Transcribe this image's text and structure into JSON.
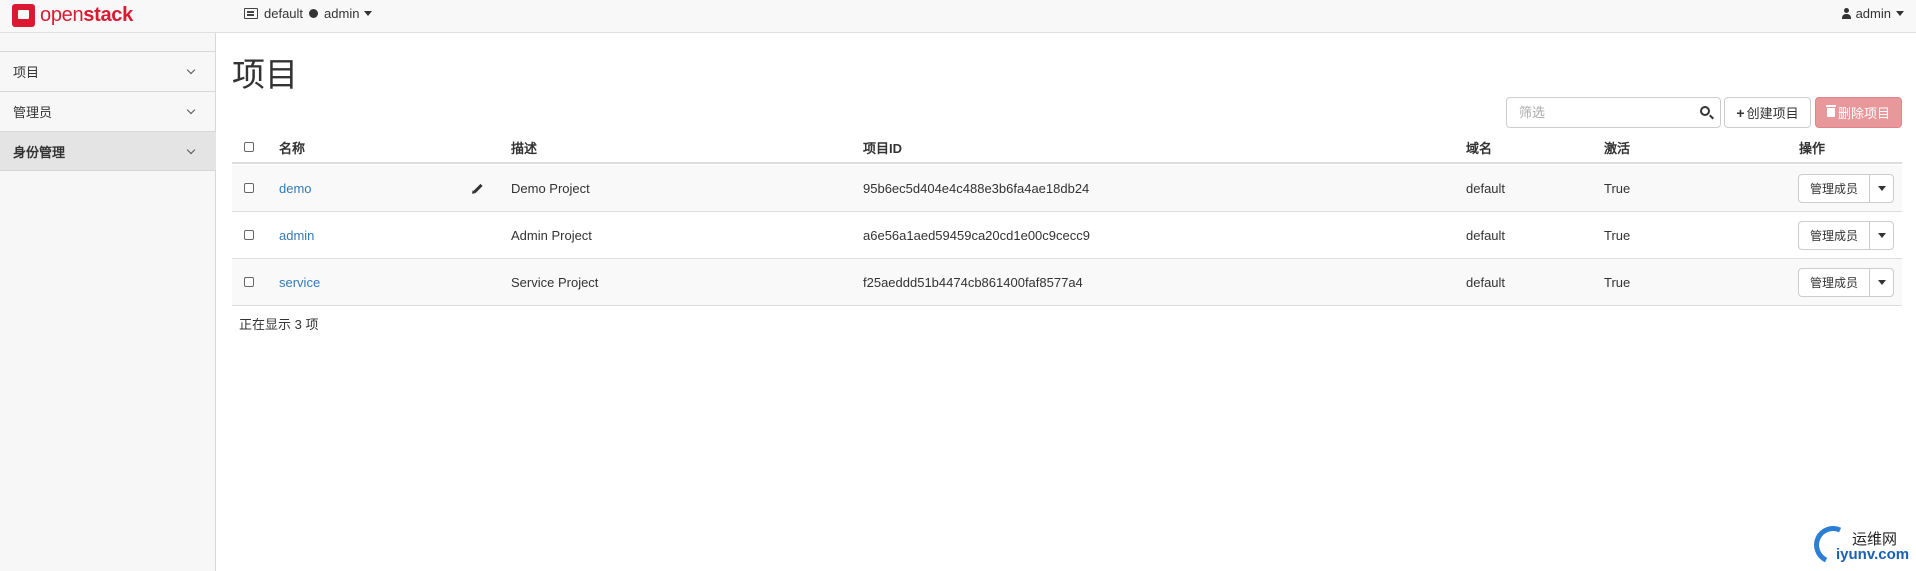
{
  "navbar": {
    "brand_open": "open",
    "brand_stack": "stack",
    "domain": "default",
    "project": "admin",
    "user": "admin"
  },
  "sidebar": {
    "items": [
      {
        "label": "项目",
        "active": false
      },
      {
        "label": "管理员",
        "active": false
      },
      {
        "label": "身份管理",
        "active": true
      }
    ]
  },
  "main": {
    "title": "项目",
    "filter_placeholder": "筛选",
    "create_label": "创建项目",
    "delete_label": "删除项目",
    "columns": [
      "名称",
      "描述",
      "项目ID",
      "域名",
      "激活",
      "操作"
    ],
    "rows": [
      {
        "name": "demo",
        "description": "Demo Project",
        "id": "95b6ec5d404e4c488e3b6fa4ae18db24",
        "domain": "default",
        "enabled": "True",
        "action": "管理成员"
      },
      {
        "name": "admin",
        "description": "Admin Project",
        "id": "a6e56a1aed59459ca20cd1e00c9cecc9",
        "domain": "default",
        "enabled": "True",
        "action": "管理成员"
      },
      {
        "name": "service",
        "description": "Service Project",
        "id": "f25aeddd51b4474cb861400faf8577a4",
        "domain": "default",
        "enabled": "True",
        "action": "管理成员"
      }
    ],
    "count_text": "正在显示 3 项"
  },
  "watermark": {
    "line1": "运维网",
    "line2": "iyunv.com"
  },
  "colors": {
    "brand": "#da1a32",
    "link": "#337ab7",
    "danger_disabled": "#e8989a"
  }
}
